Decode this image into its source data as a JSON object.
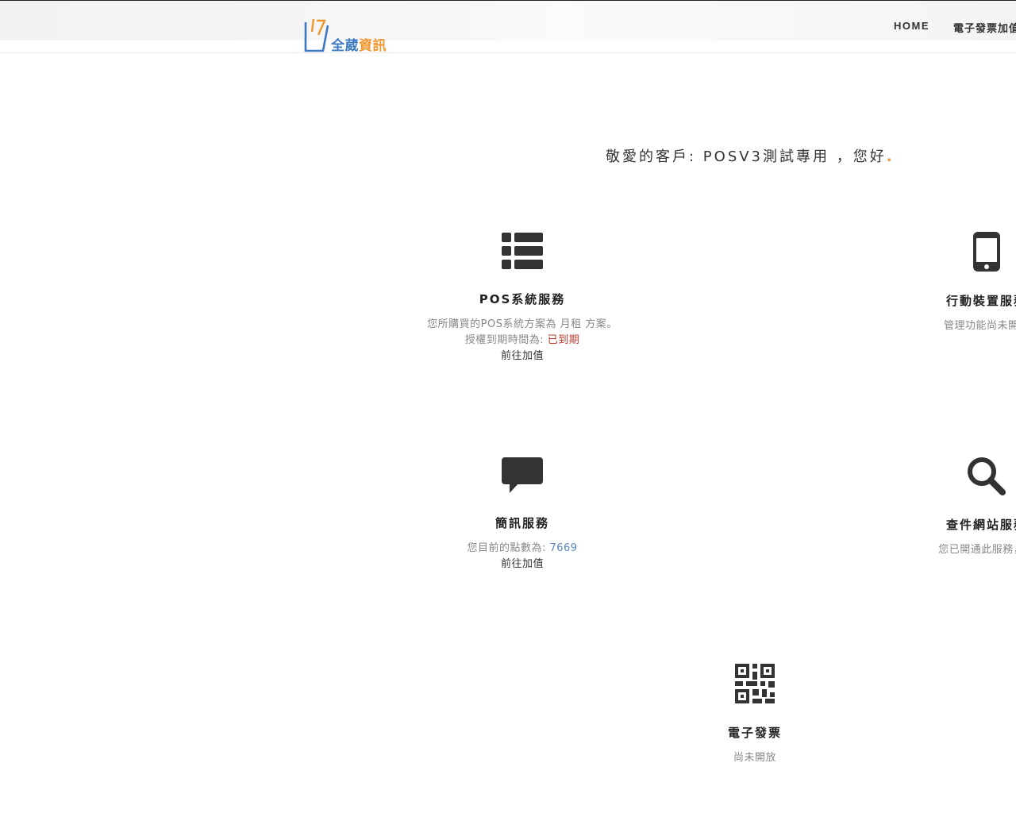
{
  "brand": {
    "name_part1": "全葳",
    "name_part2": "資訊",
    "color_blue": "#3d78c3",
    "color_orange": "#f0962e"
  },
  "nav": {
    "home": "HOME",
    "einvoice": "電子發票加值"
  },
  "greeting": {
    "prefix": "敬愛的客戶: ",
    "customer": "POSV3測試專用",
    "suffix": " ，您好",
    "dot": "."
  },
  "services": {
    "pos": {
      "icon": "list-icon",
      "title": "POS系統服務",
      "plan_prefix": "您所購買的POS系統方案為",
      "plan_value": "月租",
      "plan_suffix": "方案。",
      "expiry_prefix": "授權到期時間為:",
      "expiry_value": "已到期",
      "topup": "前往加值"
    },
    "mobile": {
      "icon": "mobile-phone-icon",
      "title": "行動裝置服務",
      "desc": "管理功能尚未開放"
    },
    "sms": {
      "icon": "chat-bubble-icon",
      "title": "簡訊服務",
      "points_prefix": "您目前的點數為:",
      "points_value": "7669",
      "topup": "前往加值"
    },
    "search": {
      "icon": "magnifier-icon",
      "title": "查件網站服務",
      "desc": "您已開通此服務，點"
    },
    "einvoice": {
      "icon": "qr-code-icon",
      "title": "電子發票",
      "desc": "尚未開放"
    }
  }
}
